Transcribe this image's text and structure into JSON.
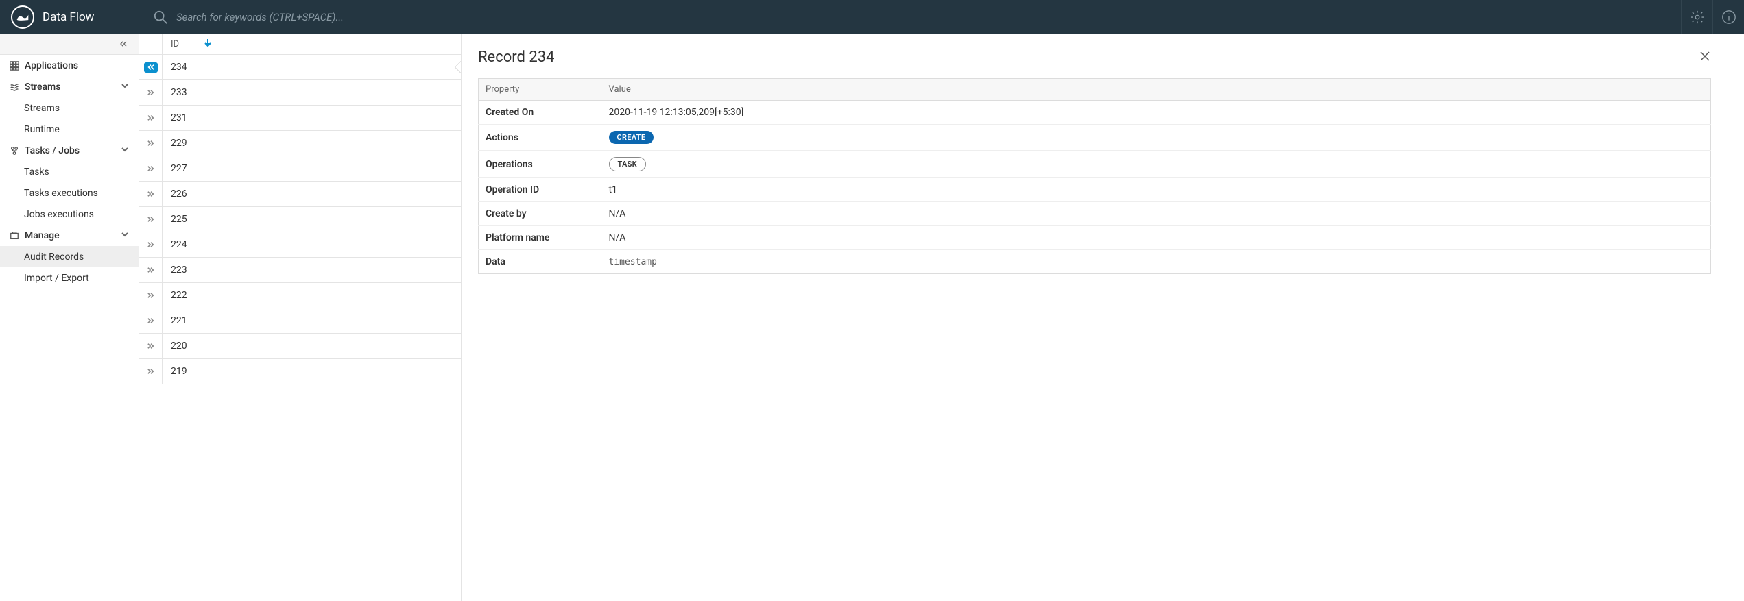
{
  "header": {
    "title": "Data Flow",
    "search_placeholder": "Search for keywords (CTRL+SPACE)..."
  },
  "sidebar": {
    "groups": [
      {
        "label": "Applications",
        "icon": "apps-icon",
        "children": null
      },
      {
        "label": "Streams",
        "icon": "stream-icon",
        "children": [
          {
            "label": "Streams"
          },
          {
            "label": "Runtime"
          }
        ]
      },
      {
        "label": "Tasks / Jobs",
        "icon": "tasks-icon",
        "children": [
          {
            "label": "Tasks"
          },
          {
            "label": "Tasks executions"
          },
          {
            "label": "Jobs executions"
          }
        ]
      },
      {
        "label": "Manage",
        "icon": "manage-icon",
        "children": [
          {
            "label": "Audit Records",
            "active": true
          },
          {
            "label": "Import / Export"
          }
        ]
      }
    ]
  },
  "list": {
    "column": "ID",
    "ids": [
      234,
      233,
      231,
      229,
      227,
      226,
      225,
      224,
      223,
      222,
      221,
      220,
      219
    ],
    "selected": 234
  },
  "detail": {
    "title": "Record 234",
    "header_property": "Property",
    "header_value": "Value",
    "rows": {
      "created_on_label": "Created On",
      "created_on_value": "2020-11-19 12:13:05,209[+5:30]",
      "actions_label": "Actions",
      "actions_badge": "CREATE",
      "operations_label": "Operations",
      "operations_badge": "TASK",
      "operation_id_label": "Operation ID",
      "operation_id_value": "t1",
      "create_by_label": "Create by",
      "create_by_value": "N/A",
      "platform_name_label": "Platform name",
      "platform_name_value": "N/A",
      "data_label": "Data",
      "data_value": "timestamp"
    }
  }
}
